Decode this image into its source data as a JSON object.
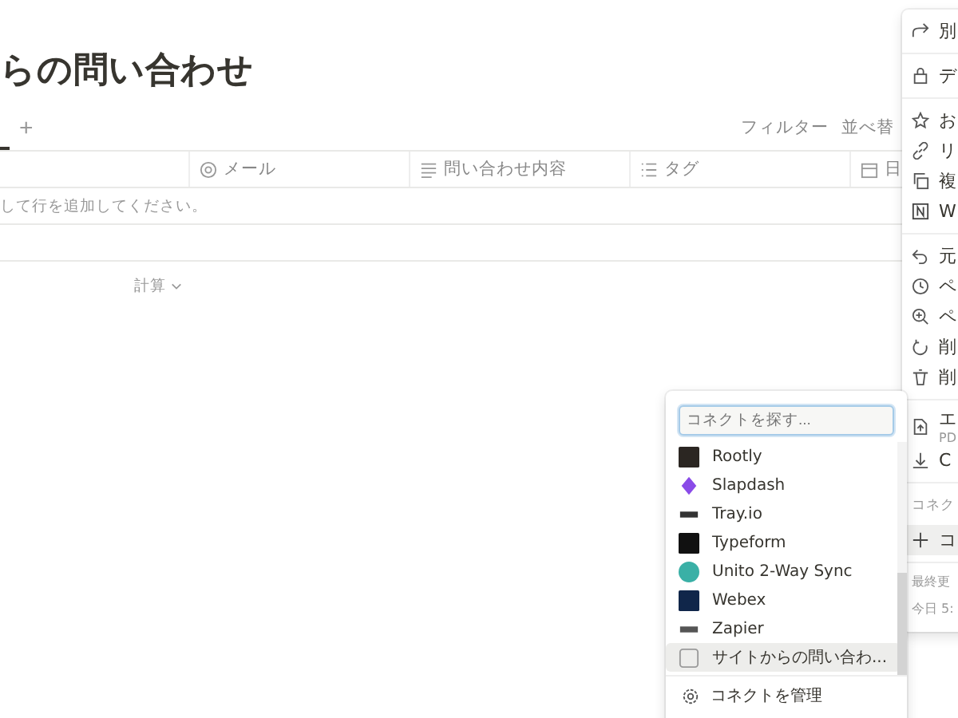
{
  "page": {
    "title": "らの問い合わせ",
    "add_view": "+"
  },
  "toolbar": [
    "フィルター",
    "並べ替"
  ],
  "table": {
    "columns": [
      {
        "label": "メール",
        "kind": "email"
      },
      {
        "label": "問い合わせ内容",
        "kind": "text"
      },
      {
        "label": "タグ",
        "kind": "list"
      },
      {
        "label": "日",
        "kind": "date"
      }
    ],
    "empty_hint": "して行を追加してください。",
    "calc": "計算"
  },
  "page_menu": {
    "groups": [
      [
        {
          "label": "別"
        }
      ],
      [
        {
          "label": "デ"
        }
      ],
      [
        {
          "label": "お"
        },
        {
          "label": "リ"
        },
        {
          "label": "複"
        },
        {
          "label": "W"
        }
      ],
      [
        {
          "label": "元"
        },
        {
          "label": "ペ"
        },
        {
          "label": "ペ"
        },
        {
          "label": "削"
        },
        {
          "label": "削"
        }
      ],
      [
        {
          "label": "エ",
          "sub": "PD"
        },
        {
          "label": "C"
        }
      ]
    ],
    "section": "コネク",
    "connect_item": {
      "label": "コ",
      "highlighted": true
    },
    "footer": [
      "最終更",
      "今日 5:"
    ]
  },
  "connect_popup": {
    "placeholder": "コネクトを探す...",
    "items": [
      {
        "label": "Rootly",
        "color": "#2b2622",
        "selected": false
      },
      {
        "label": "Slapdash",
        "color": "#8a4be8",
        "selected": false
      },
      {
        "label": "Tray.io",
        "color": "#333333",
        "selected": false
      },
      {
        "label": "Typeform",
        "color": "#111111",
        "selected": false
      },
      {
        "label": "Unito 2-Way Sync",
        "color": "#3ab0a6",
        "selected": false
      },
      {
        "label": "Webex",
        "color": "#10264a",
        "selected": false
      },
      {
        "label": "Zapier",
        "color": "#555555",
        "selected": false
      },
      {
        "label": "サイトからの問い合わ...",
        "color": "#9a9a9a",
        "selected": true
      }
    ],
    "manage": "コネクトを管理"
  }
}
